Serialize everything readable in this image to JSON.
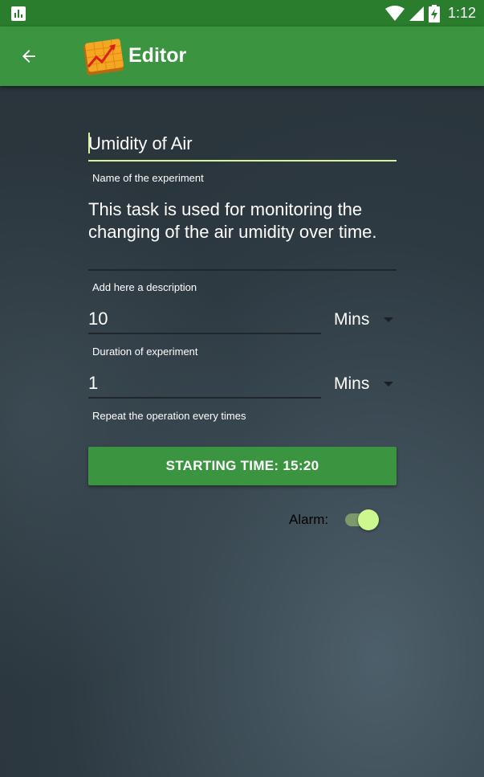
{
  "status_bar": {
    "time": "1:12",
    "icons": [
      "chart-icon",
      "wifi-icon",
      "signal-icon",
      "battery-charging-icon"
    ]
  },
  "app_bar": {
    "title": "Editor",
    "back_icon": "arrow-back-icon",
    "logo_icon": "chart-logo-icon"
  },
  "form": {
    "name": {
      "value": "Umidity of Air",
      "caption": "Name of the experiment"
    },
    "description": {
      "value": "This task is used for monitoring the changing of the air umidity over time.",
      "caption": "Add here a description"
    },
    "duration": {
      "value": "10",
      "unit": "Mins",
      "caption": "Duration of experiment"
    },
    "repeat": {
      "value": "1",
      "unit": "Mins",
      "caption": "Repeat the operation every times"
    },
    "start_button": "STARTING TIME: 15:20",
    "alarm": {
      "label": "Alarm:",
      "on": true
    }
  },
  "colors": {
    "status_bar": "#2b7d2e",
    "app_bar": "#3a9440",
    "accent": "#ccf98f",
    "button": "#3a9440"
  }
}
